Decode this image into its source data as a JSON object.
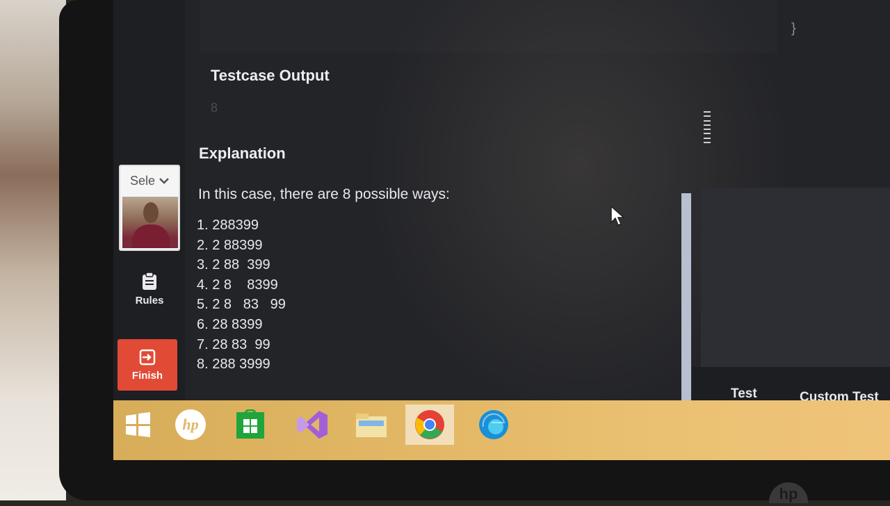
{
  "sidebar": {
    "language_select": "Sele",
    "rules_label": "Rules",
    "finish_label": "Finish"
  },
  "main": {
    "output_title": "Testcase Output",
    "output_value": "8",
    "explanation_title": "Explanation",
    "explanation_intro": "In this case, there are 8 possible ways:",
    "ways": [
      "1. 288399",
      "2. 2 88399",
      "3. 2 88  399",
      "4. 2 8    8399",
      "5. 2 8   83   99",
      "6. 28 8399",
      "7. 28 83  99",
      "8. 288 3999"
    ]
  },
  "right_panel": {
    "brace": "}",
    "test_label": "Test",
    "custom_test_label": "Custom Test"
  },
  "taskbar": {
    "icons": [
      "windows-start-icon",
      "hp-support-icon",
      "store-icon",
      "visual-studio-icon",
      "file-explorer-icon",
      "chrome-icon",
      "edge-icon"
    ]
  },
  "colors": {
    "finish": "#e14a35",
    "taskbar": "#e2b866",
    "background": "#232428"
  },
  "device_logo": "hp"
}
